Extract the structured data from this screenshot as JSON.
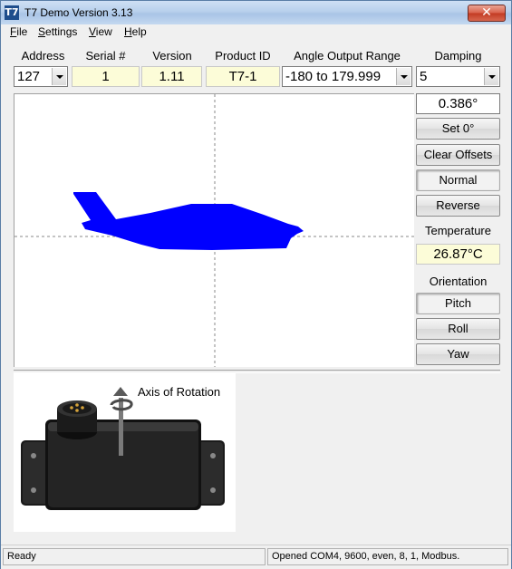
{
  "window": {
    "title": "T7 Demo Version 3.13",
    "icon_text": "T7",
    "close_glyph": "✕"
  },
  "menu": [
    {
      "mnemonic": "F",
      "rest": "ile"
    },
    {
      "mnemonic": "S",
      "rest": "ettings"
    },
    {
      "mnemonic": "V",
      "rest": "iew"
    },
    {
      "mnemonic": "H",
      "rest": "elp"
    }
  ],
  "headers": {
    "address": "Address",
    "serial": "Serial #",
    "version": "Version",
    "product_id": "Product ID",
    "angle_range": "Angle Output Range",
    "damping": "Damping"
  },
  "values": {
    "address": "127",
    "serial": "1",
    "version": "1.11",
    "product_id": "T7-1",
    "angle_range": "-180 to 179.999",
    "damping": "5"
  },
  "side": {
    "angle_readout": "0.386°",
    "set_zero": "Set 0°",
    "clear_offsets": "Clear Offsets",
    "normal": "Normal",
    "reverse": "Reverse",
    "temperature_label": "Temperature",
    "temperature_value": "26.87°C",
    "orientation_label": "Orientation",
    "pitch": "Pitch",
    "roll": "Roll",
    "yaw": "Yaw"
  },
  "sensor_image": {
    "axis_label": "Axis of Rotation"
  },
  "status": {
    "left": "Ready",
    "right": "Opened COM4, 9600, even, 8, 1, Modbus."
  },
  "colors": {
    "aircraft": "#0000ff",
    "readonly_bg": "#fcfcd8"
  }
}
